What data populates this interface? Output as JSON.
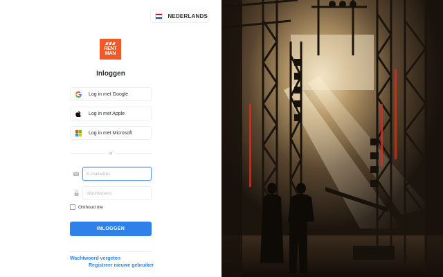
{
  "language": {
    "label": "NEDERLANDS",
    "flag_colors": [
      "#ae1c28",
      "#ffffff",
      "#21468b"
    ]
  },
  "brand": {
    "logo_text_line1": "RENT",
    "logo_text_line2": "MAN",
    "color": "#f05a28"
  },
  "login": {
    "title": "Inloggen",
    "google_label": "Log in met Google",
    "apple_label": "Log in met Apple",
    "microsoft_label": "Log in met Microsoft",
    "or_label": "or",
    "email_placeholder": "E-mailadres",
    "password_placeholder": "Wachtwoord",
    "remember_label": "Onthoud me",
    "submit_label": "INLOGGEN",
    "forgot_link": "Wachtwoord vergeten",
    "register_link": "Registreer nieuwe gebruiker"
  },
  "colors": {
    "primary": "#2f80e8",
    "border": "#eceef2",
    "text": "#2b2f36"
  },
  "icons": [
    "google-icon",
    "apple-icon",
    "microsoft-icon",
    "mail-icon",
    "lock-icon",
    "flag-nl-icon"
  ]
}
